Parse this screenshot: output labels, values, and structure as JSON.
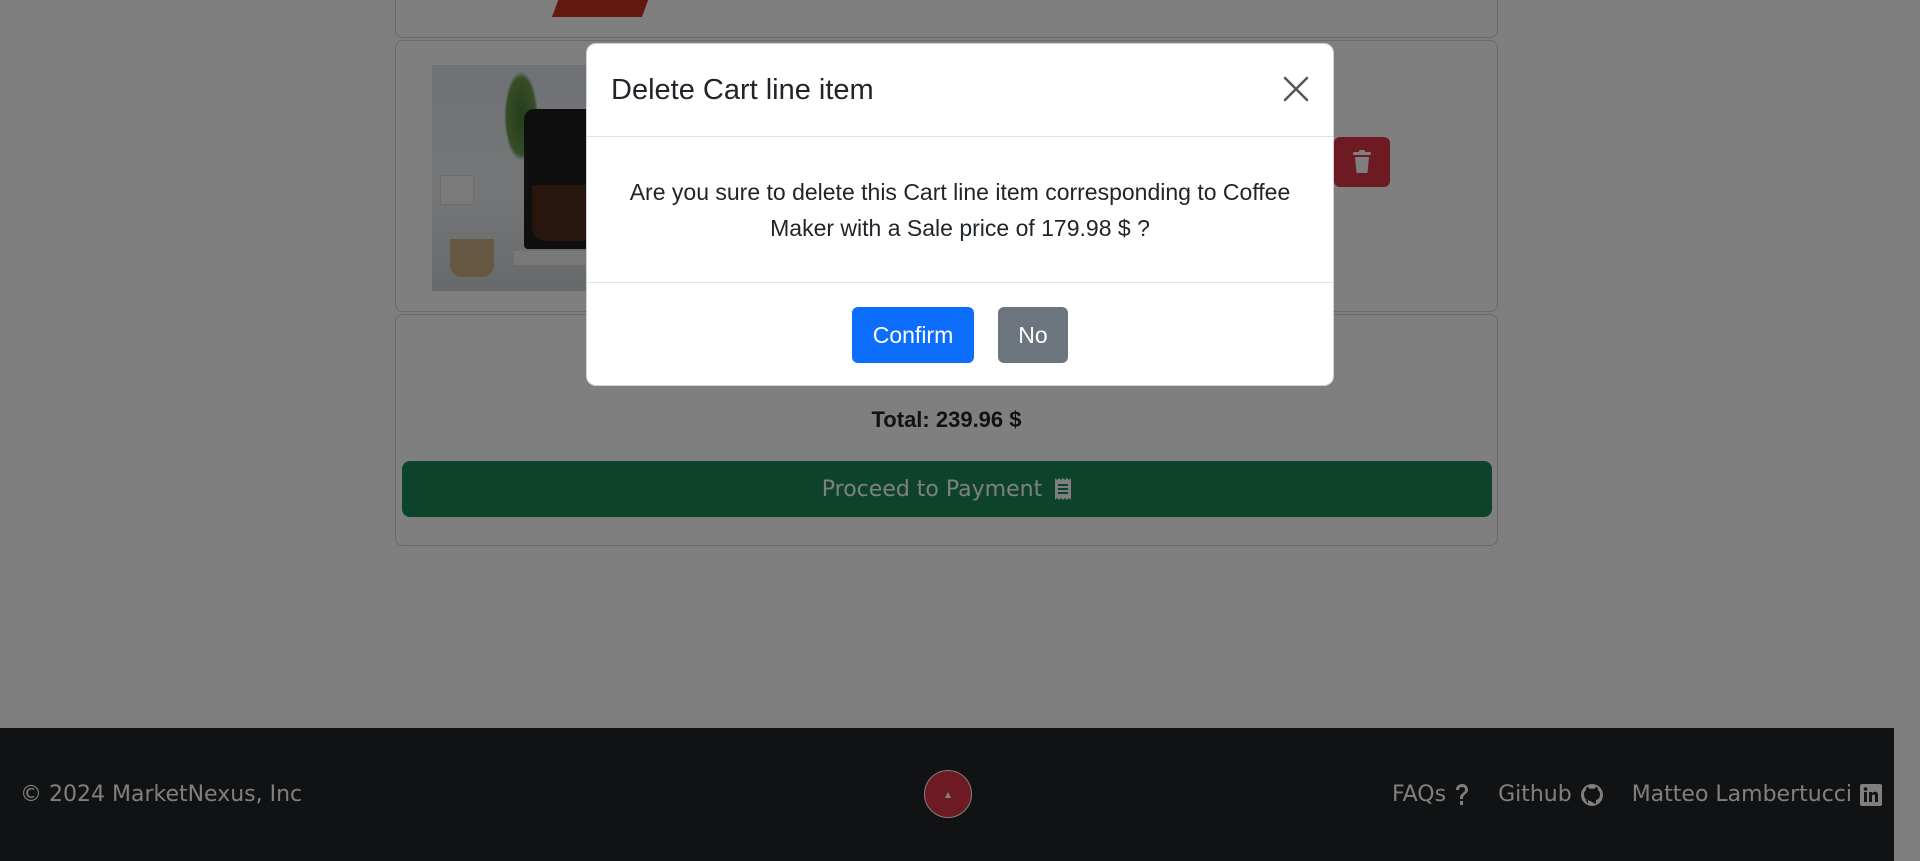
{
  "modal": {
    "title": "Delete Cart line item",
    "message": "Are you sure to delete this Cart line item corresponding to Coffee Maker with a Sale price of 179.98 $ ?",
    "confirm_label": "Confirm",
    "no_label": "No",
    "close_icon": "close-icon"
  },
  "cart": {
    "total": "Total: 239.96 $",
    "proceed_label": "Proceed to Payment",
    "proceed_icon": "receipt-icon",
    "delete_icon": "trash-icon"
  },
  "footer": {
    "copyright": "© 2024 MarketNexus, Inc",
    "links": [
      {
        "label": "FAQs",
        "icon": "question-icon"
      },
      {
        "label": "Github",
        "icon": "github-icon"
      },
      {
        "label": "Matteo Lambertucci",
        "icon": "linkedin-icon"
      }
    ]
  },
  "colors": {
    "primary": "#0d6efd",
    "secondary": "#6c757d",
    "success": "#198754",
    "danger": "#dc3545",
    "footer_bg": "#212529"
  }
}
